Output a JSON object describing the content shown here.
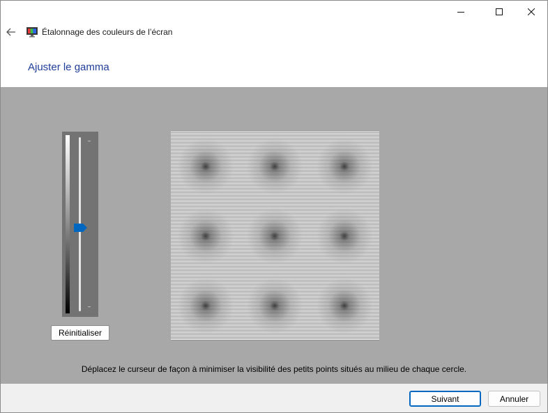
{
  "window": {
    "title": "Étalonnage des couleurs de l’écran",
    "caption_buttons": [
      {
        "name": "minimize",
        "icon": "minimize-icon"
      },
      {
        "name": "maximize",
        "icon": "maximize-icon"
      },
      {
        "name": "close",
        "icon": "close-icon"
      }
    ]
  },
  "nav": {
    "back_icon": "back-arrow-icon",
    "app_icon": "display-color-calibration-icon"
  },
  "page": {
    "heading": "Ajuster le gamma",
    "instruction": "Déplacez le curseur de façon à minimiser la visibilité des petits points situés au milieu de chaque cercle."
  },
  "gamma_slider": {
    "value_fraction_from_top": 0.52,
    "thumb_color": "#0067c0",
    "reset_label": "Réinitialiser"
  },
  "test_pattern": {
    "rows": 3,
    "columns": 3
  },
  "footer": {
    "next_label": "Suivant",
    "cancel_label": "Annuler"
  },
  "colors": {
    "accent": "#0067c0",
    "heading": "#1f3d99",
    "content_background": "#a8a8a8",
    "footer_background": "#f0f0f0"
  }
}
